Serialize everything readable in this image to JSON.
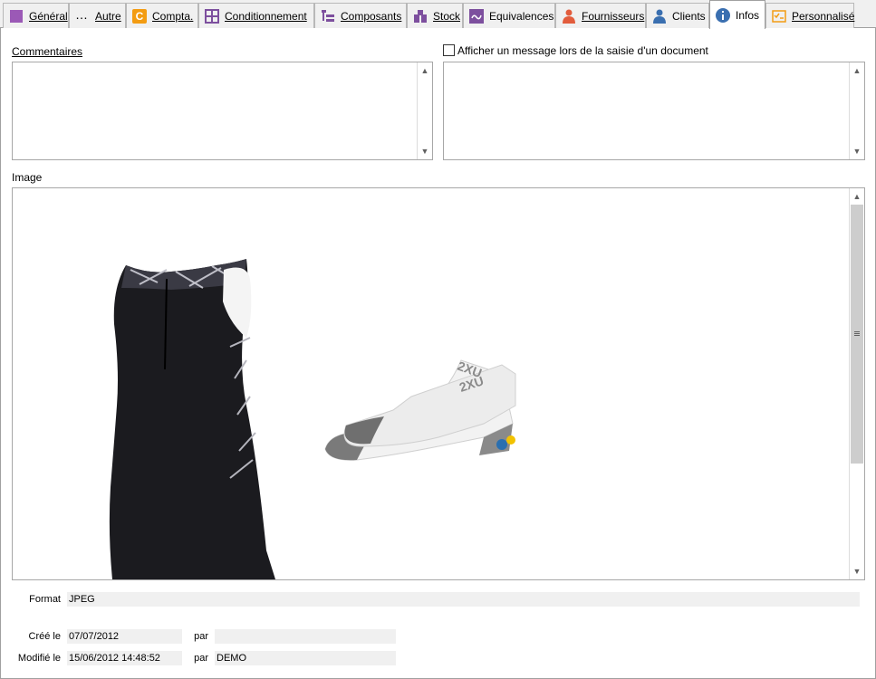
{
  "tabs": [
    {
      "label": "Général",
      "icon": "purple-square-icon",
      "color": "#9b59b6"
    },
    {
      "label": "Autre",
      "icon": "ellipsis-icon",
      "color": "#333333"
    },
    {
      "label": "Compta.",
      "icon": "accounting-icon",
      "color": "#f39c12"
    },
    {
      "label": "Conditionnement",
      "icon": "grid-icon",
      "color": "#7d4f9e"
    },
    {
      "label": "Composants",
      "icon": "tree-icon",
      "color": "#7d4f9e"
    },
    {
      "label": "Stock",
      "icon": "stock-icon",
      "color": "#7d4f9e"
    },
    {
      "label": "Equivalences",
      "icon": "equivalence-icon",
      "color": "#7d4f9e"
    },
    {
      "label": "Fournisseurs",
      "icon": "supplier-icon",
      "color": "#e25c3c"
    },
    {
      "label": "Clients",
      "icon": "client-icon",
      "color": "#3a6fb0"
    },
    {
      "label": "Infos",
      "icon": "info-icon",
      "color": "#3a6fb0",
      "active": true
    },
    {
      "label": "Personnalisé",
      "icon": "custom-icon",
      "color": "#f39c12"
    }
  ],
  "comments": {
    "label": "Commentaires",
    "value": ""
  },
  "message": {
    "label": "Afficher un message lors de la saisie d'un document",
    "checked": false,
    "value": ""
  },
  "image": {
    "label": "Image",
    "content": "product-photo-trisuit-and-socks"
  },
  "info": {
    "format_label": "Format",
    "format_value": "JPEG",
    "created_label": "Créé le",
    "created_value": "07/07/2012",
    "created_by_label": "par",
    "created_by_value": "",
    "modified_label": "Modifié le",
    "modified_value": "15/06/2012 14:48:52",
    "modified_by_label": "par",
    "modified_by_value": "DEMO"
  }
}
